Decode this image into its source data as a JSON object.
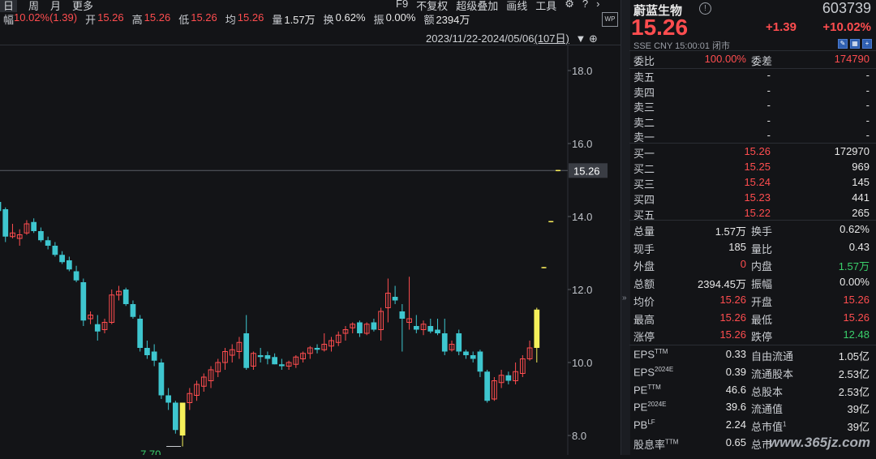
{
  "tabs": {
    "day": "日",
    "week": "周",
    "month": "月",
    "more": "更多"
  },
  "tools": {
    "f9": "F9",
    "fq": "不复权",
    "overlay": "超级叠加",
    "draw": "画线",
    "toolbox": "工具"
  },
  "quote": {
    "amp_label": "幅",
    "amp_value": "10.02%(1.39)",
    "open_label": "开",
    "open_value": "15.26",
    "high_label": "高",
    "high_value": "15.26",
    "low_label": "低",
    "low_value": "15.26",
    "avg_label": "均",
    "avg_value": "15.26",
    "vol_label": "量",
    "vol_value": "1.57万",
    "turn_label": "换",
    "turn_value": "0.62%",
    "swing_label": "振",
    "swing_value": "0.00%",
    "amt_label": "额",
    "amt_value": "2394万"
  },
  "range": {
    "text": "2023/11/22-2024/05/06",
    "days": "(107日)"
  },
  "axis": {
    "ticks": [
      "18.0",
      "16.0",
      "14.0",
      "12.0",
      "10.0",
      "8.0"
    ],
    "last_price_tag": "15.26",
    "low_label": "7.70"
  },
  "chart_data": {
    "type": "candlestick",
    "ylim": [
      7.5,
      18.8
    ],
    "colors": {
      "up": "#ff4d4f",
      "down": "#3ec6cf",
      "limit": "#f5f05a"
    },
    "candles": [
      {
        "o": 14.4,
        "h": 14.55,
        "l": 13.95,
        "c": 14.15
      },
      {
        "o": 14.2,
        "h": 14.25,
        "l": 13.3,
        "c": 13.45
      },
      {
        "o": 13.45,
        "h": 13.8,
        "l": 13.4,
        "c": 13.55
      },
      {
        "o": 13.4,
        "h": 13.65,
        "l": 13.2,
        "c": 13.5
      },
      {
        "o": 13.55,
        "h": 13.9,
        "l": 13.5,
        "c": 13.8
      },
      {
        "o": 13.85,
        "h": 13.95,
        "l": 13.55,
        "c": 13.6
      },
      {
        "o": 13.6,
        "h": 13.7,
        "l": 13.3,
        "c": 13.35
      },
      {
        "o": 13.35,
        "h": 13.45,
        "l": 13.1,
        "c": 13.2
      },
      {
        "o": 13.2,
        "h": 13.3,
        "l": 12.9,
        "c": 12.95
      },
      {
        "o": 12.95,
        "h": 13.05,
        "l": 12.7,
        "c": 12.75
      },
      {
        "o": 12.8,
        "h": 12.9,
        "l": 12.5,
        "c": 12.55
      },
      {
        "o": 12.5,
        "h": 12.65,
        "l": 12.2,
        "c": 12.25
      },
      {
        "o": 12.2,
        "h": 12.3,
        "l": 11.0,
        "c": 11.15
      },
      {
        "o": 11.2,
        "h": 11.4,
        "l": 11.05,
        "c": 11.3
      },
      {
        "o": 11.05,
        "h": 11.3,
        "l": 10.6,
        "c": 10.85
      },
      {
        "o": 10.9,
        "h": 11.2,
        "l": 10.8,
        "c": 11.1
      },
      {
        "o": 11.1,
        "h": 12.0,
        "l": 11.05,
        "c": 11.85
      },
      {
        "o": 11.85,
        "h": 12.1,
        "l": 11.7,
        "c": 11.95
      },
      {
        "o": 12.0,
        "h": 12.05,
        "l": 11.55,
        "c": 11.6
      },
      {
        "o": 11.6,
        "h": 11.7,
        "l": 11.2,
        "c": 11.25
      },
      {
        "o": 11.2,
        "h": 11.3,
        "l": 10.3,
        "c": 10.4
      },
      {
        "o": 10.4,
        "h": 10.6,
        "l": 10.1,
        "c": 10.2
      },
      {
        "o": 10.3,
        "h": 10.5,
        "l": 9.9,
        "c": 10.05
      },
      {
        "o": 10.0,
        "h": 10.1,
        "l": 9.0,
        "c": 9.1
      },
      {
        "o": 9.1,
        "h": 9.3,
        "l": 8.7,
        "c": 8.9
      },
      {
        "o": 8.9,
        "h": 8.95,
        "l": 8.05,
        "c": 8.15
      },
      {
        "o": 8.0,
        "h": 8.9,
        "l": 7.7,
        "c": 8.9
      },
      {
        "o": 8.9,
        "h": 9.3,
        "l": 8.7,
        "c": 9.15
      },
      {
        "o": 9.1,
        "h": 9.5,
        "l": 8.95,
        "c": 9.4
      },
      {
        "o": 9.35,
        "h": 9.7,
        "l": 9.2,
        "c": 9.6
      },
      {
        "o": 9.5,
        "h": 9.9,
        "l": 9.3,
        "c": 9.8
      },
      {
        "o": 9.75,
        "h": 10.1,
        "l": 9.6,
        "c": 10.0
      },
      {
        "o": 10.0,
        "h": 10.4,
        "l": 9.8,
        "c": 10.3
      },
      {
        "o": 10.2,
        "h": 10.5,
        "l": 10.0,
        "c": 10.35
      },
      {
        "o": 10.3,
        "h": 10.7,
        "l": 10.1,
        "c": 10.55
      },
      {
        "o": 10.8,
        "h": 11.3,
        "l": 9.8,
        "c": 9.85
      },
      {
        "o": 9.9,
        "h": 10.3,
        "l": 9.8,
        "c": 10.25
      },
      {
        "o": 10.2,
        "h": 10.4,
        "l": 10.0,
        "c": 10.15
      },
      {
        "o": 10.2,
        "h": 10.3,
        "l": 9.95,
        "c": 10.1
      },
      {
        "o": 10.15,
        "h": 10.25,
        "l": 9.95,
        "c": 9.95
      },
      {
        "o": 9.95,
        "h": 10.1,
        "l": 9.8,
        "c": 9.9
      },
      {
        "o": 9.9,
        "h": 10.05,
        "l": 9.8,
        "c": 10.0
      },
      {
        "o": 9.95,
        "h": 10.2,
        "l": 9.85,
        "c": 10.15
      },
      {
        "o": 10.1,
        "h": 10.3,
        "l": 10.0,
        "c": 10.25
      },
      {
        "o": 10.25,
        "h": 10.45,
        "l": 10.1,
        "c": 10.4
      },
      {
        "o": 10.4,
        "h": 10.5,
        "l": 10.25,
        "c": 10.35
      },
      {
        "o": 10.35,
        "h": 10.8,
        "l": 10.3,
        "c": 10.5
      },
      {
        "o": 10.45,
        "h": 10.7,
        "l": 10.3,
        "c": 10.6
      },
      {
        "o": 10.55,
        "h": 10.85,
        "l": 10.45,
        "c": 10.75
      },
      {
        "o": 10.8,
        "h": 11.0,
        "l": 10.6,
        "c": 10.9
      },
      {
        "o": 10.95,
        "h": 11.1,
        "l": 10.8,
        "c": 11.05
      },
      {
        "o": 11.1,
        "h": 11.15,
        "l": 10.7,
        "c": 10.8
      },
      {
        "o": 10.8,
        "h": 11.1,
        "l": 10.75,
        "c": 11.05
      },
      {
        "o": 11.1,
        "h": 11.2,
        "l": 10.85,
        "c": 10.9
      },
      {
        "o": 10.9,
        "h": 11.5,
        "l": 10.6,
        "c": 11.4
      },
      {
        "o": 11.5,
        "h": 12.3,
        "l": 11.1,
        "c": 11.9
      },
      {
        "o": 11.8,
        "h": 12.1,
        "l": 11.6,
        "c": 11.7
      },
      {
        "o": 11.4,
        "h": 11.6,
        "l": 10.3,
        "c": 11.2
      },
      {
        "o": 11.1,
        "h": 12.35,
        "l": 10.9,
        "c": 11.2
      },
      {
        "o": 11.0,
        "h": 11.3,
        "l": 10.8,
        "c": 10.9
      },
      {
        "o": 10.9,
        "h": 11.15,
        "l": 10.75,
        "c": 11.05
      },
      {
        "o": 11.0,
        "h": 11.2,
        "l": 10.8,
        "c": 10.85
      },
      {
        "o": 10.9,
        "h": 11.2,
        "l": 10.75,
        "c": 10.8
      },
      {
        "o": 10.8,
        "h": 11.2,
        "l": 10.2,
        "c": 10.3
      },
      {
        "o": 10.35,
        "h": 10.6,
        "l": 10.3,
        "c": 10.5
      },
      {
        "o": 10.8,
        "h": 10.9,
        "l": 10.2,
        "c": 10.3
      },
      {
        "o": 10.3,
        "h": 10.35,
        "l": 10.1,
        "c": 10.2
      },
      {
        "o": 10.2,
        "h": 10.3,
        "l": 10.0,
        "c": 10.1
      },
      {
        "o": 10.3,
        "h": 10.35,
        "l": 9.6,
        "c": 9.75
      },
      {
        "o": 9.75,
        "h": 9.8,
        "l": 8.9,
        "c": 8.95
      },
      {
        "o": 9.0,
        "h": 9.6,
        "l": 8.95,
        "c": 9.5
      },
      {
        "o": 9.45,
        "h": 9.8,
        "l": 9.3,
        "c": 9.65
      },
      {
        "o": 9.65,
        "h": 9.75,
        "l": 9.4,
        "c": 9.5
      },
      {
        "o": 9.5,
        "h": 10.0,
        "l": 9.4,
        "c": 9.75
      },
      {
        "o": 9.7,
        "h": 10.2,
        "l": 9.6,
        "c": 10.1
      },
      {
        "o": 10.1,
        "h": 10.6,
        "l": 10.05,
        "c": 10.4
      },
      {
        "o": 10.4,
        "h": 11.5,
        "l": 10.0,
        "c": 11.45
      },
      {
        "o": 12.6,
        "h": 12.62,
        "l": 12.58,
        "c": 12.6
      },
      {
        "o": 13.86,
        "h": 13.88,
        "l": 13.84,
        "c": 13.86
      },
      {
        "o": 15.26,
        "h": 15.28,
        "l": 15.24,
        "c": 15.26
      }
    ]
  },
  "panel": {
    "name": "蔚蓝生物",
    "code": "603739",
    "price": "15.26",
    "chg": "+1.39",
    "chgpct": "+10.02%",
    "meta": "SSE  CNY  15:00:01  闭市",
    "webi_label": "委比",
    "webi_value": "100.00%",
    "weicha_label": "委差",
    "weicha_value": "174790",
    "sells": [
      {
        "label": "卖五",
        "price": "-",
        "vol": "-"
      },
      {
        "label": "卖四",
        "price": "-",
        "vol": "-"
      },
      {
        "label": "卖三",
        "price": "-",
        "vol": "-"
      },
      {
        "label": "卖二",
        "price": "-",
        "vol": "-"
      },
      {
        "label": "卖一",
        "price": "-",
        "vol": "-"
      }
    ],
    "buys": [
      {
        "label": "买一",
        "price": "15.26",
        "vol": "172970"
      },
      {
        "label": "买二",
        "price": "15.25",
        "vol": "969"
      },
      {
        "label": "买三",
        "price": "15.24",
        "vol": "145"
      },
      {
        "label": "买四",
        "price": "15.23",
        "vol": "441"
      },
      {
        "label": "买五",
        "price": "15.22",
        "vol": "265"
      }
    ],
    "stats": [
      {
        "l1": "总量",
        "v1": "1.57万",
        "c1": "white",
        "l2": "换手",
        "v2": "0.62%",
        "c2": "white"
      },
      {
        "l1": "现手",
        "v1": "185",
        "c1": "white",
        "l2": "量比",
        "v2": "0.43",
        "c2": "white"
      },
      {
        "l1": "外盘",
        "v1": "0",
        "c1": "red",
        "l2": "内盘",
        "v2": "1.57万",
        "c2": "green"
      },
      {
        "l1": "总额",
        "v1": "2394.45万",
        "c1": "white",
        "l2": "振幅",
        "v2": "0.00%",
        "c2": "white"
      },
      {
        "l1": "均价",
        "v1": "15.26",
        "c1": "red",
        "l2": "开盘",
        "v2": "15.26",
        "c2": "red"
      },
      {
        "l1": "最高",
        "v1": "15.26",
        "c1": "red",
        "l2": "最低",
        "v2": "15.26",
        "c2": "red"
      },
      {
        "l1": "涨停",
        "v1": "15.26",
        "c1": "red",
        "l2": "跌停",
        "v2": "12.48",
        "c2": "green"
      }
    ],
    "fund": [
      {
        "l1": "EPS",
        "s1": "TTM",
        "v1": "0.33",
        "l2": "自由流通",
        "s2": "",
        "v2": "1.05亿"
      },
      {
        "l1": "EPS",
        "s1": "2024E",
        "v1": "0.39",
        "l2": "流通股本",
        "s2": "",
        "v2": "2.53亿"
      },
      {
        "l1": "PE",
        "s1": "TTM",
        "v1": "46.6",
        "l2": "总股本",
        "s2": "",
        "v2": "2.53亿"
      },
      {
        "l1": "PE",
        "s1": "2024E",
        "v1": "39.6",
        "l2": "流通值",
        "s2": "",
        "v2": "39亿"
      },
      {
        "l1": "PB",
        "s1": "LF",
        "v1": "2.24",
        "l2": "总市值",
        "s2": "1",
        "v2": "39亿"
      },
      {
        "l1": "股息率",
        "s1": "TTM",
        "v1": "0.65",
        "l2": "总市",
        "s2": "",
        "v2": ""
      }
    ],
    "watermark": "www.365jz.com"
  }
}
